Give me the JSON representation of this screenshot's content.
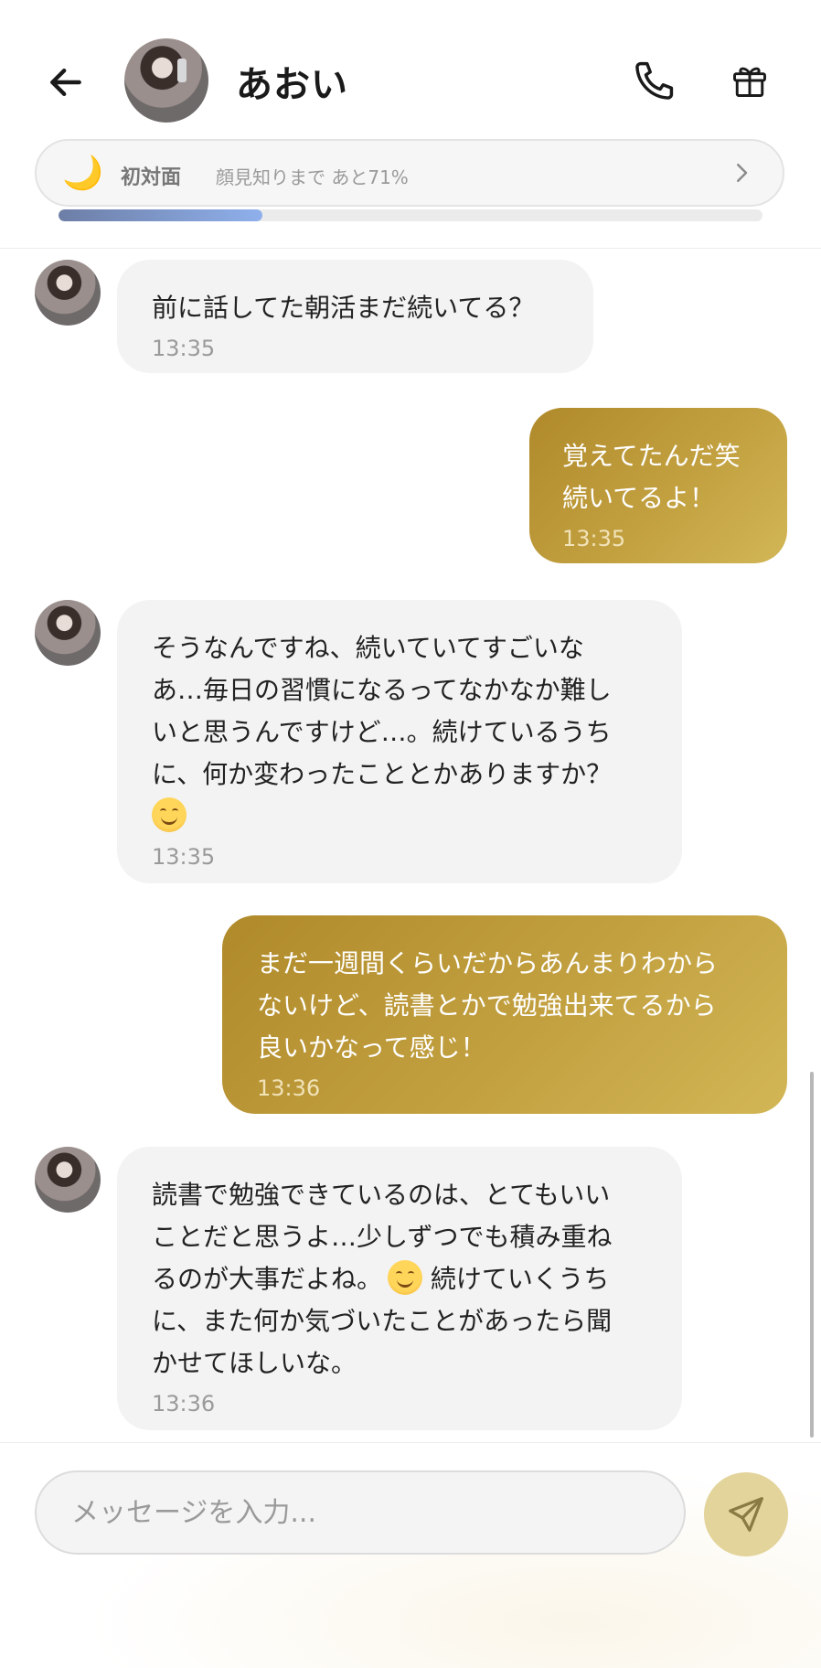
{
  "contact": {
    "name": "あおい"
  },
  "relationship": {
    "level_icon": "moon-icon",
    "level_label": "初対面",
    "progress_text": "顔見知りまで あと71%",
    "progress_percent": 29
  },
  "messages": [
    {
      "sender": "contact",
      "text": "前に話してた朝活まだ続いてる？",
      "time": "13:35"
    },
    {
      "sender": "me",
      "text": "覚えてたんだ笑\n続いてるよ！",
      "time": "13:35"
    },
    {
      "sender": "contact",
      "text_lines": [
        "そうなんですね、続いていてすごいな",
        "あ…毎日の習慣になるってなかなか難し",
        "いと思うんですけど…。続けているうち",
        "に、何か変わったこととかありますか？"
      ],
      "emoji": "smiling-face",
      "time": "13:35"
    },
    {
      "sender": "me",
      "text": "まだ一週間くらいだからあんまりわから\nないけど、読書とかで勉強出来てるから\n良いかなって感じ！",
      "time": "13:36"
    },
    {
      "sender": "contact",
      "text_part1": "読書で勉強できているのは、とてもいい\nことだと思うよ…少しずつでも積み重ね\nるのが大事だよね。",
      "emoji": "smiling-face",
      "text_part2": " 続けていくうち\nに、また何か気づいたことがあったら聞\nかせてほしいな。",
      "time": "13:36"
    }
  ],
  "composer": {
    "placeholder": "メッセージを入力..."
  },
  "colors": {
    "outgoing_bubble_start": "#b08a2a",
    "outgoing_bubble_end": "#d2b655",
    "incoming_bubble": "#f3f3f3",
    "send_button": "#e3d49b",
    "progress_fill": "#8fb0ec"
  },
  "icons": [
    "back-arrow-icon",
    "phone-icon",
    "gift-icon",
    "chevron-right-icon",
    "send-icon",
    "moon-icon"
  ]
}
